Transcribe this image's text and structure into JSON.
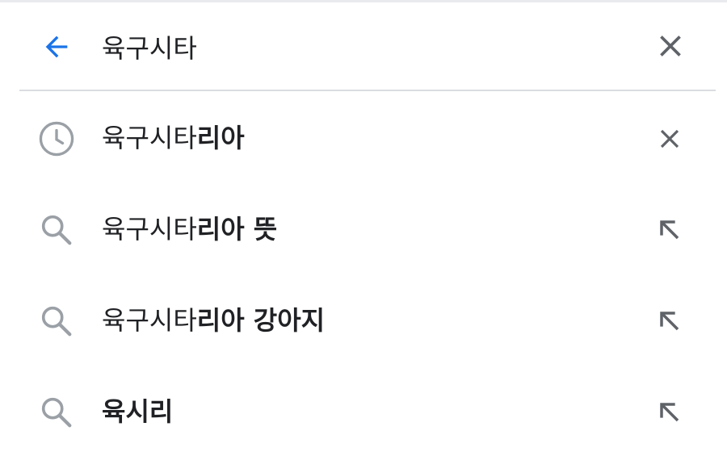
{
  "search": {
    "query": "육구시타",
    "back_icon": "arrow-back-icon",
    "clear_icon": "close-icon",
    "accent_color": "#1a73e8",
    "icon_color": "#5f6368"
  },
  "suggestions": [
    {
      "type": "history",
      "prefix": "육구시타",
      "completion": "리아",
      "lead_icon": "clock-icon",
      "trail_icon": "close-icon"
    },
    {
      "type": "query",
      "prefix": "육구시타",
      "completion": "리아 뜻",
      "lead_icon": "search-icon",
      "trail_icon": "arrow-up-left-icon"
    },
    {
      "type": "query",
      "prefix": "육구시타",
      "completion": "리아 강아지",
      "lead_icon": "search-icon",
      "trail_icon": "arrow-up-left-icon"
    },
    {
      "type": "query",
      "prefix": "",
      "completion": "육시리",
      "lead_icon": "search-icon",
      "trail_icon": "arrow-up-left-icon"
    }
  ]
}
